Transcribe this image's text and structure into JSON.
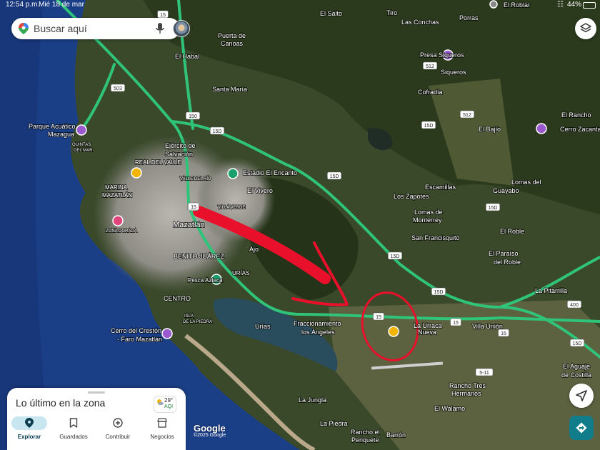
{
  "status_bar": {
    "time": "12:54 p.m.",
    "date": "Mié 18 de mar",
    "battery": "44%"
  },
  "search": {
    "placeholder": "Buscar aquí"
  },
  "map": {
    "places": [
      "El Salto",
      "Tiro",
      "Las Conchas",
      "Porras",
      "El Roblar",
      "Puerta de",
      "Canoas",
      "El Habal",
      "Presa Siqueros",
      "Siqueros",
      "Santa María",
      "Cofradía",
      "El Rancho",
      "Cerro Zacanta",
      "Parque Acuático",
      "Mazagua",
      "QUINTAS",
      "DEL MAR",
      "Ejército de",
      "Salvación",
      "El Bajío",
      "REAL DEL VALLE",
      "VALLE DEL RÍO",
      "Estadio El Encanto",
      "Lomas del",
      "Guayabo",
      "MARINA",
      "MAZATLÁN",
      "Escamillas",
      "El Vivero",
      "VILLA VERDE",
      "Los Zapotes",
      "Lomas de",
      "Monterrey",
      "El Roble",
      "ZONA DORADA",
      "Mazatlán",
      "Ajo",
      "San Francisquito",
      "El Paraíso",
      "del Roble",
      "BENITO JUÁREZ",
      "URÍAS",
      "La Pitarrilla",
      "Pesca Azteca",
      "CENTRO",
      "ISLA",
      "DE LA PIEDRA",
      "Cerro del Crestón",
      "- Faro Mazatlán",
      "Urías",
      "Fraccionamiento",
      "los Ángeles",
      "La Urraca",
      "Nueva",
      "Villa Unión",
      "El Aguaje",
      "de Costilla",
      "Rancho Tres",
      "Hermanos",
      "La Jungla",
      "La Piedra",
      "El Walamo",
      "Rancho el",
      "Periquete",
      "Barrón"
    ],
    "highway_shields": [
      "15",
      "15D",
      "15",
      "150",
      "503",
      "15",
      "512",
      "15D",
      "15D",
      "512",
      "15D",
      "15",
      "15",
      "15D",
      "400",
      "15D",
      "15",
      "15D",
      "5-11"
    ]
  },
  "bottom_sheet": {
    "title": "Lo último en la zona",
    "weather": {
      "temp": "29°",
      "aqi": "AQI"
    },
    "nav": [
      {
        "label": "Explorar",
        "icon": "pin-icon",
        "active": true
      },
      {
        "label": "Guardados",
        "icon": "bookmark-icon",
        "active": false
      },
      {
        "label": "Contribuir",
        "icon": "plus-circle-icon",
        "active": false
      },
      {
        "label": "Negocios",
        "icon": "store-icon",
        "active": false
      }
    ]
  },
  "attribution": {
    "logo": "Google",
    "copyright": "©2025 Google"
  },
  "colors": {
    "highway": "#2fc47a",
    "annotation": "#e8102a",
    "directions": "#127d8a",
    "active_tab": "#c8e6f0"
  }
}
